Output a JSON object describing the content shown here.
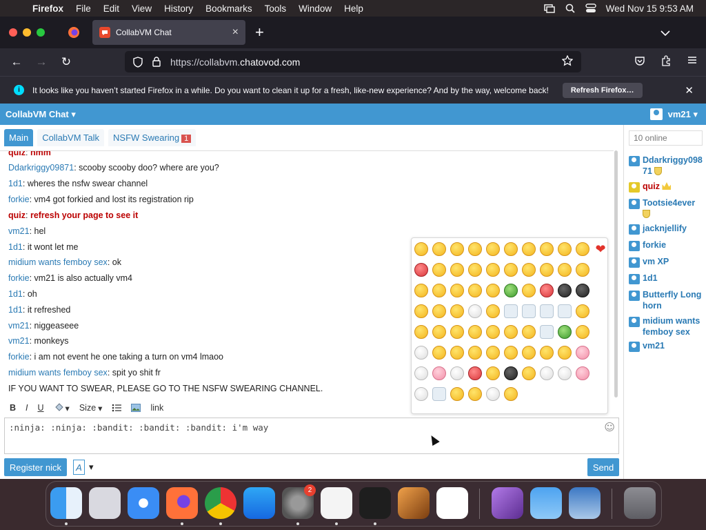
{
  "menubar": {
    "app": "Firefox",
    "items": [
      "File",
      "Edit",
      "View",
      "History",
      "Bookmarks",
      "Tools",
      "Window",
      "Help"
    ],
    "clock": "Wed Nov 15  9:53 AM"
  },
  "browser": {
    "tab_title": "CollabVM Chat",
    "url_prefix": "https://collabvm.",
    "url_domain": "chatovod.com",
    "notice_text": "It looks like you haven’t started Firefox in a while. Do you want to clean it up for a fresh, like-new experience? And by the way, welcome back!",
    "notice_button": "Refresh Firefox…"
  },
  "chat": {
    "title": "CollabVM Chat ▾",
    "username": "vm21 ▾",
    "tabs": [
      {
        "label": "Main"
      },
      {
        "label": "CollabVM Talk"
      },
      {
        "label": "NSFW Swearing",
        "badge": "1"
      }
    ],
    "messages": [
      {
        "nick": "quiz",
        "text": "hmm",
        "red": true
      },
      {
        "nick": "Ddarkriggy09871",
        "text": "scooby scooby doo? where are you?"
      },
      {
        "nick": "1d1",
        "text": "wheres the nsfw swear channel"
      },
      {
        "nick": "forkie",
        "text": "vm4 got forkied and lost its registration rip"
      },
      {
        "nick": "quiz",
        "text": "refresh your page to see it",
        "red": true
      },
      {
        "nick": "vm21",
        "text": "hel"
      },
      {
        "nick": "1d1",
        "text": "it wont let me"
      },
      {
        "nick": "midium wants femboy sex",
        "text": "ok"
      },
      {
        "nick": "forkie",
        "text": "vm21 is also actually vm4"
      },
      {
        "nick": "1d1",
        "text": "oh"
      },
      {
        "nick": "1d1",
        "text": "it refreshed"
      },
      {
        "nick": "vm21",
        "text": "niggeaseee"
      },
      {
        "nick": "vm21",
        "text": "monkeys"
      },
      {
        "nick": "forkie",
        "text": "i am not event he one taking a turn on vm4 lmaoo"
      },
      {
        "nick": "midium wants femboy sex",
        "text": "spit yo shit fr"
      }
    ],
    "system_message": "IF YOU WANT TO SWEAR, PLEASE GO TO THE NSFW SWEARING CHANNEL.",
    "toolbar": {
      "bold": "B",
      "italic": "I",
      "underline": "U",
      "size": "Size",
      "link": "link"
    },
    "composer_value": ":ninja: :ninja: :bandit: :bandit: :bandit: i'm way",
    "register_button": "Register nick",
    "font_button": "A",
    "send_button": "Send"
  },
  "sidebar": {
    "online_count": "10 online",
    "users": [
      {
        "name": "Ddarkriggy09871",
        "badge": "shield"
      },
      {
        "name": "quiz",
        "badge": "crown",
        "red": true
      },
      {
        "name": "Tootsie4ever",
        "badge": "shield"
      },
      {
        "name": "jacknjellify"
      },
      {
        "name": "forkie"
      },
      {
        "name": "vm XP"
      },
      {
        "name": "1d1"
      },
      {
        "name": "Butterfly Longhorn"
      },
      {
        "name": "midium wants femboy sex"
      },
      {
        "name": "vm21"
      }
    ]
  },
  "dock": {
    "apps": [
      "Finder",
      "Launchpad",
      "Safari",
      "Firefox",
      "Chrome",
      "App Store",
      "System Settings",
      "TextEdit",
      "Terminal",
      "GarageBand",
      "VS Code",
      "Visual Studio",
      "Weather",
      "VirtualBox",
      "Trash"
    ],
    "settings_badge": "2"
  }
}
